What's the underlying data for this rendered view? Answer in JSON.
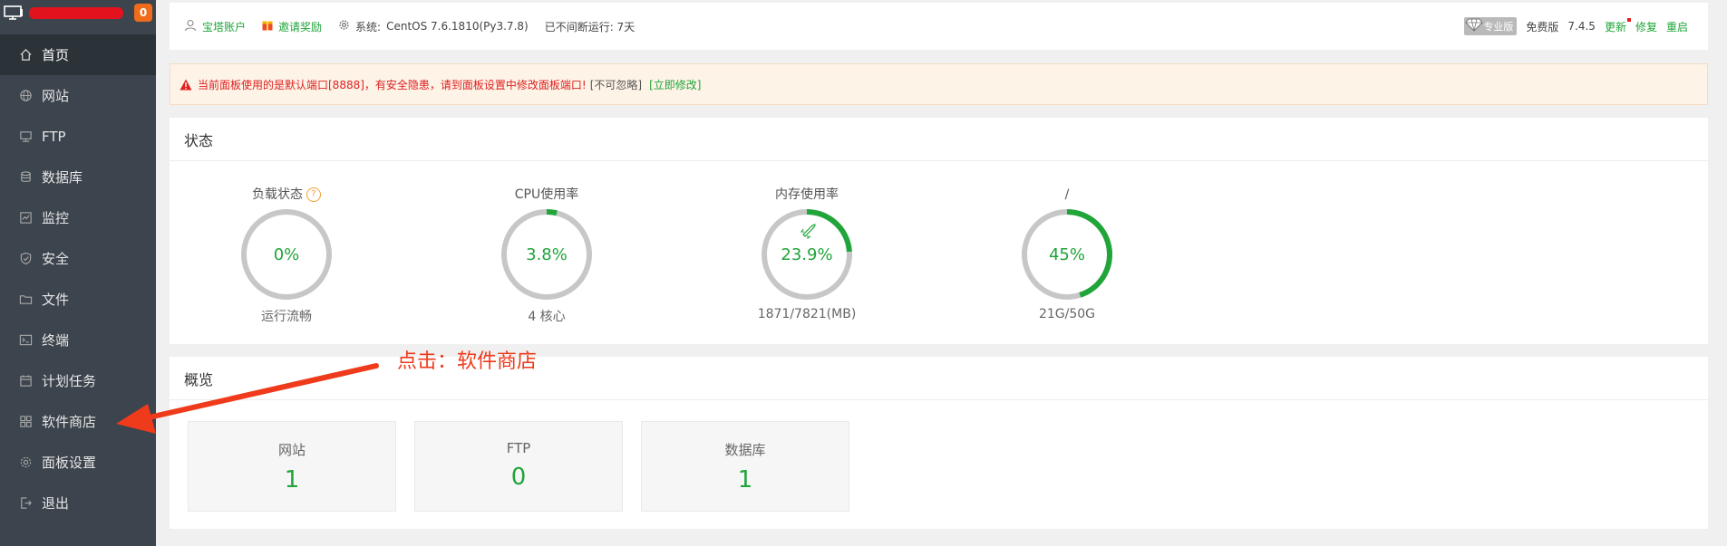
{
  "sidebar": {
    "badge": "0",
    "items": [
      {
        "label": "首页",
        "icon": "home-icon",
        "active": true
      },
      {
        "label": "网站",
        "icon": "globe-icon"
      },
      {
        "label": "FTP",
        "icon": "ftp-icon"
      },
      {
        "label": "数据库",
        "icon": "database-icon"
      },
      {
        "label": "监控",
        "icon": "monitor-icon"
      },
      {
        "label": "安全",
        "icon": "shield-icon"
      },
      {
        "label": "文件",
        "icon": "folder-icon"
      },
      {
        "label": "终端",
        "icon": "terminal-icon"
      },
      {
        "label": "计划任务",
        "icon": "calendar-icon"
      },
      {
        "label": "软件商店",
        "icon": "grid-icon"
      },
      {
        "label": "面板设置",
        "icon": "gear-icon"
      },
      {
        "label": "退出",
        "icon": "logout-icon"
      }
    ]
  },
  "topbar": {
    "account": "宝塔账户",
    "invite": "邀请奖励",
    "system_label": "系统:",
    "system_value": "CentOS 7.6.1810(Py3.7.8)",
    "uptime": "已不间断运行: 7天",
    "pro_label": "专业版",
    "free_label": "免费版",
    "version": "7.4.5",
    "update": "更新",
    "repair": "修复",
    "restart": "重启"
  },
  "alert": {
    "message": "当前面板使用的是默认端口[8888]，有安全隐患，请到面板设置中修改面板端口!",
    "ignore": "[不可忽略]",
    "fix": "[立即修改]"
  },
  "status": {
    "title": "状态",
    "gauges": [
      {
        "label": "负载状态",
        "value": "0%",
        "percent": 0,
        "sub": "运行流畅",
        "help": "?"
      },
      {
        "label": "CPU使用率",
        "value": "3.8%",
        "percent": 3.8,
        "sub": "4 核心"
      },
      {
        "label": "内存使用率",
        "value": "23.9%",
        "percent": 23.9,
        "sub": "1871/7821(MB)"
      },
      {
        "label": "/",
        "value": "45%",
        "percent": 45,
        "sub": "21G/50G"
      }
    ]
  },
  "overview": {
    "title": "概览",
    "cards": [
      {
        "label": "网站",
        "value": "1"
      },
      {
        "label": "FTP",
        "value": "0"
      },
      {
        "label": "数据库",
        "value": "1"
      }
    ]
  },
  "annotation": {
    "text": "点击：软件商店"
  },
  "colors": {
    "accent": "#20a53a",
    "sidebar_bg": "#3c444d",
    "alert_red": "#e02020",
    "annotation": "#ef3a1b"
  }
}
